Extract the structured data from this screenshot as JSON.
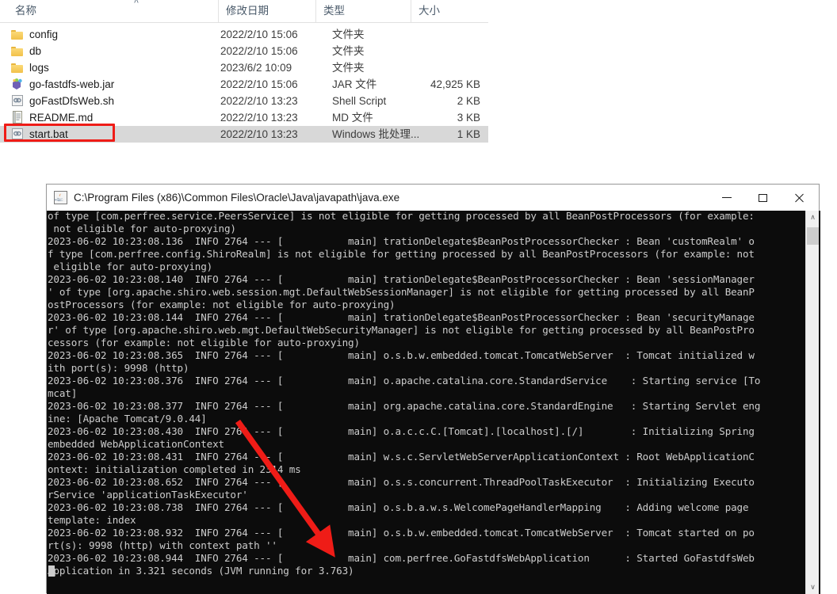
{
  "explorer": {
    "columns": [
      {
        "key": "name",
        "label": "名称"
      },
      {
        "key": "date",
        "label": "修改日期"
      },
      {
        "key": "type",
        "label": "类型"
      },
      {
        "key": "size",
        "label": "大小"
      }
    ],
    "sort_indicator": "˄",
    "rows": [
      {
        "icon": "folder-icon",
        "name": "config",
        "date": "2022/2/10 15:06",
        "type": "文件夹",
        "size": "",
        "selected": false
      },
      {
        "icon": "folder-icon",
        "name": "db",
        "date": "2022/2/10 15:06",
        "type": "文件夹",
        "size": "",
        "selected": false
      },
      {
        "icon": "folder-icon",
        "name": "logs",
        "date": "2023/6/2 10:09",
        "type": "文件夹",
        "size": "",
        "selected": false
      },
      {
        "icon": "jar-file-icon",
        "name": "go-fastdfs-web.jar",
        "date": "2022/2/10 15:06",
        "type": "JAR 文件",
        "size": "42,925 KB",
        "selected": false
      },
      {
        "icon": "shell-script-icon",
        "name": "goFastDfsWeb.sh",
        "date": "2022/2/10 13:23",
        "type": "Shell Script",
        "size": "2 KB",
        "selected": false
      },
      {
        "icon": "markdown-file-icon",
        "name": "README.md",
        "date": "2022/2/10 13:23",
        "type": "MD 文件",
        "size": "3 KB",
        "selected": false
      },
      {
        "icon": "batch-file-icon",
        "name": "start.bat",
        "date": "2022/2/10 13:23",
        "type": "Windows 批处理...",
        "size": "1 KB",
        "selected": true
      }
    ],
    "highlight_color": "#ef1c17"
  },
  "console": {
    "title": "C:\\Program Files (x86)\\Common Files\\Oracle\\Java\\javapath\\java.exe",
    "window_buttons": {
      "minimize": "—",
      "maximize": "□",
      "close": "✕"
    },
    "scrollbar": {
      "up_arrow": "∧",
      "down_arrow": "∨"
    },
    "background_color": "#0c0c0c",
    "text_color": "#cccccc",
    "lines": [
      "of type [com.perfree.service.PeersService] is not eligible for getting processed by all BeanPostProcessors (for example:",
      " not eligible for auto-proxying)",
      "2023-06-02 10:23:08.136  INFO 2764 --- [           main] trationDelegate$BeanPostProcessorChecker : Bean 'customRealm' o",
      "f type [com.perfree.config.ShiroRealm] is not eligible for getting processed by all BeanPostProcessors (for example: not",
      " eligible for auto-proxying)",
      "2023-06-02 10:23:08.140  INFO 2764 --- [           main] trationDelegate$BeanPostProcessorChecker : Bean 'sessionManager",
      "' of type [org.apache.shiro.web.session.mgt.DefaultWebSessionManager] is not eligible for getting processed by all BeanP",
      "ostProcessors (for example: not eligible for auto-proxying)",
      "2023-06-02 10:23:08.144  INFO 2764 --- [           main] trationDelegate$BeanPostProcessorChecker : Bean 'securityManage",
      "r' of type [org.apache.shiro.web.mgt.DefaultWebSecurityManager] is not eligible for getting processed by all BeanPostPro",
      "cessors (for example: not eligible for auto-proxying)",
      "2023-06-02 10:23:08.365  INFO 2764 --- [           main] o.s.b.w.embedded.tomcat.TomcatWebServer  : Tomcat initialized w",
      "ith port(s): 9998 (http)",
      "2023-06-02 10:23:08.376  INFO 2764 --- [           main] o.apache.catalina.core.StandardService    : Starting service [To",
      "mcat]",
      "2023-06-02 10:23:08.377  INFO 2764 --- [           main] org.apache.catalina.core.StandardEngine   : Starting Servlet eng",
      "ine: [Apache Tomcat/9.0.44]",
      "2023-06-02 10:23:08.430  INFO 2764 --- [           main] o.a.c.c.C.[Tomcat].[localhost].[/]        : Initializing Spring",
      "embedded WebApplicationContext",
      "2023-06-02 10:23:08.431  INFO 2764 --- [           main] w.s.c.ServletWebServerApplicationContext : Root WebApplicationC",
      "ontext: initialization completed in 2314 ms",
      "2023-06-02 10:23:08.652  INFO 2764 --- [           main] o.s.s.concurrent.ThreadPoolTaskExecutor  : Initializing Executo",
      "rService 'applicationTaskExecutor'",
      "2023-06-02 10:23:08.738  INFO 2764 --- [           main] o.s.b.a.w.s.WelcomePageHandlerMapping    : Adding welcome page",
      "template: index",
      "2023-06-02 10:23:08.932  INFO 2764 --- [           main] o.s.b.w.embedded.tomcat.TomcatWebServer  : Tomcat started on po",
      "rt(s): 9998 (http) with context path ''",
      "2023-06-02 10:23:08.944  INFO 2764 --- [           main] com.perfree.GoFastdfsWebApplication      : Started GoFastdfsWeb",
      "Application in 3.321 seconds (JVM running for 3.763)"
    ]
  },
  "annotation": {
    "arrow_color": "#ef1c17",
    "arrow_from": "300,532",
    "arrow_to": "415,692"
  }
}
